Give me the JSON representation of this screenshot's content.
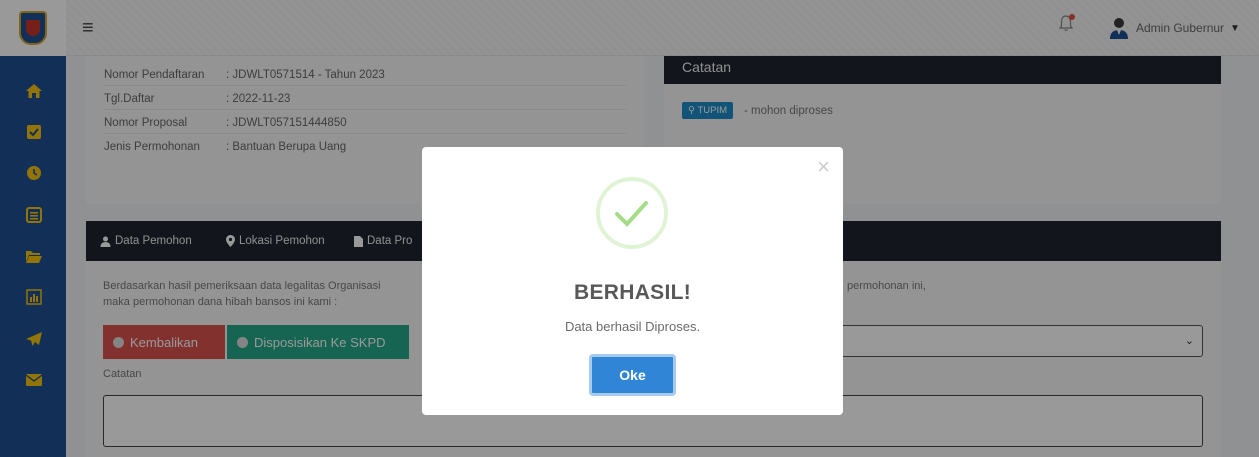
{
  "header": {
    "menu_icon": "hamburger-icon",
    "user_label": "Admin Gubernur"
  },
  "info": {
    "rows": [
      {
        "label": "Nomor Pendaftaran",
        "value": ": JDWLT0571514 - Tahun 2023"
      },
      {
        "label": "Tgl.Daftar",
        "value": ": 2022-11-23"
      },
      {
        "label": "Nomor Proposal",
        "value": ": JDWLT057151444850"
      },
      {
        "label": "Jenis Permohonan",
        "value": ": Bantuan Berupa Uang"
      }
    ]
  },
  "note": {
    "title": "Catatan",
    "badge": "TUPIM",
    "text": "- mohon diproses"
  },
  "tabs": [
    {
      "label": "Data Pemohon",
      "icon": "user-icon"
    },
    {
      "label": "Lokasi Pemohon",
      "icon": "map-marker-icon"
    },
    {
      "label": "Data Pro",
      "icon": "file-icon"
    }
  ],
  "main": {
    "paragraph_line1": "Berdasarkan hasil pemeriksaan data legalitas Organisasi",
    "paragraph_line2": "maka permohonan dana hibah bansos ini kami :",
    "paragraph_right": "permohonan ini,",
    "btn_kembalikan": "Kembalikan",
    "btn_disposisi": "Disposisikan Ke SKPD",
    "catatan_label": "Catatan"
  },
  "modal": {
    "title": "BERHASIL!",
    "text": "Data berhasil Diproses.",
    "ok_label": "Oke",
    "close_glyph": "×"
  },
  "colors": {
    "sidebar": "#1d4f91",
    "icon_yellow": "#f4c20d",
    "danger": "#d9534f",
    "success": "#26a98a",
    "primary": "#3085d6",
    "check": "#a5dc86"
  }
}
